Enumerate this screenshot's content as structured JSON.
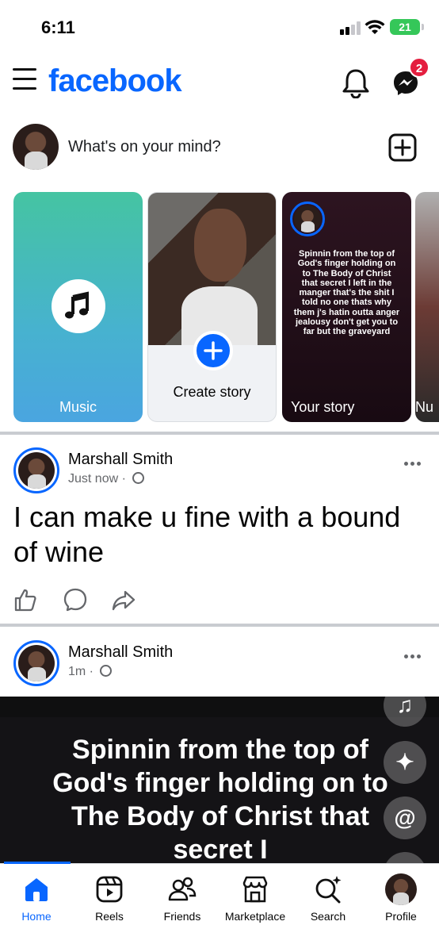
{
  "status_bar": {
    "time": "6:11",
    "battery": "21"
  },
  "header": {
    "logo": "facebook",
    "messenger_badge": "2"
  },
  "composer": {
    "prompt": "What's on your mind?"
  },
  "stories": [
    {
      "label": "Music"
    },
    {
      "label": "Create story"
    },
    {
      "label": "Your story",
      "text": "Spinnin from the top of God's finger holding on to The Body of Christ that secret I left in the manger that's the shit I told no one thats why them j's hatin outta anger jealousy don't get you to far but the graveyard"
    },
    {
      "label": "Nu"
    }
  ],
  "posts": [
    {
      "author": "Marshall Smith",
      "time": "Just now",
      "text": "I can make u fine with a bound of wine"
    },
    {
      "author": "Marshall Smith",
      "time": "1m",
      "video_text": "Spinnin from the top of God's finger holding on to The Body of Christ that secret I"
    }
  ],
  "nav": {
    "home": "Home",
    "reels": "Reels",
    "friends": "Friends",
    "marketplace": "Marketplace",
    "search": "Search",
    "profile": "Profile"
  },
  "icons": {
    "like": "thumbs-up-icon",
    "comment": "comment-icon",
    "share": "share-icon",
    "music": "music-note-icon",
    "sparkle": "sparkle-icon",
    "mention": "at-icon"
  },
  "colors": {
    "brand": "#0866ff",
    "badge": "#e41e3f"
  }
}
